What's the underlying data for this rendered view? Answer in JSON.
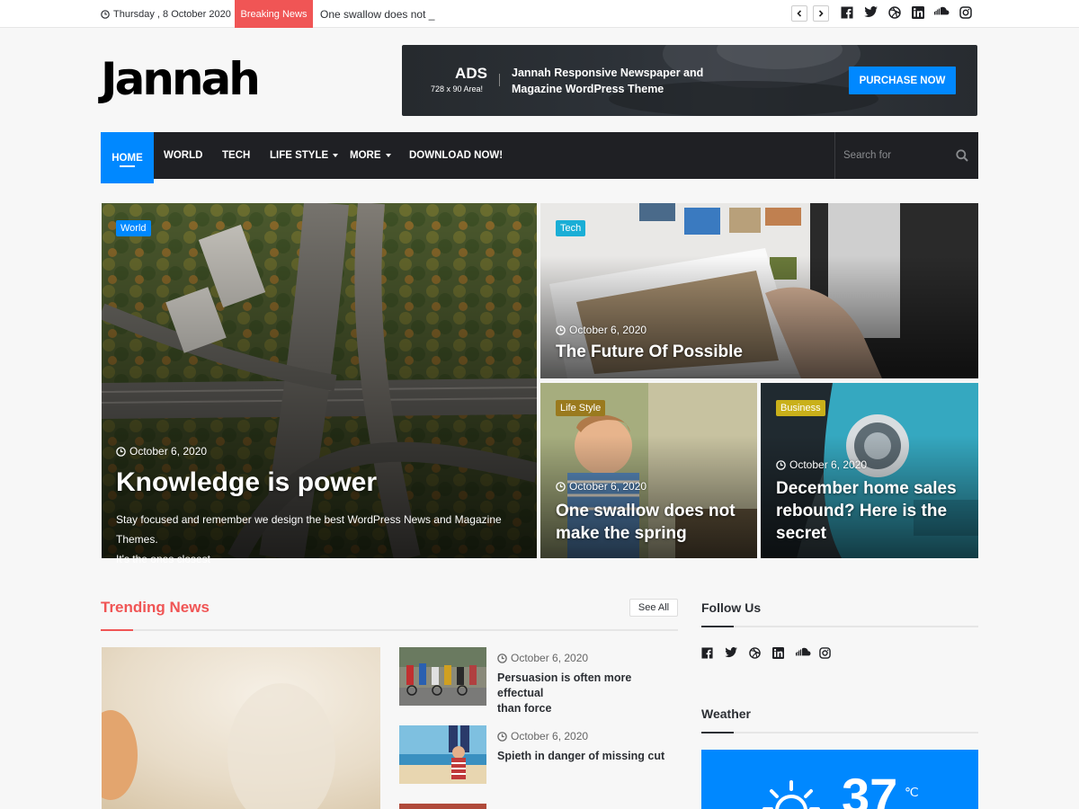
{
  "topbar": {
    "date": "Thursday , 8 October 2020",
    "breaking_label": "Breaking News",
    "ticker_text": "One swallow does not _",
    "social_icons": [
      "facebook-icon",
      "twitter-icon",
      "dribbble-icon",
      "linkedin-icon",
      "soundcloud-icon",
      "instagram-icon"
    ]
  },
  "header": {
    "logo": "Jannah",
    "ad": {
      "title": "ADS",
      "subtitle": "728 x 90 Area!",
      "text_line1": "Jannah Responsive Newspaper and",
      "text_line2": "Magazine WordPress Theme",
      "button": "PURCHASE NOW"
    }
  },
  "nav": {
    "items": [
      {
        "label": "HOME"
      },
      {
        "label": "WORLD"
      },
      {
        "label": "TECH"
      },
      {
        "label": "LIFE STYLE"
      },
      {
        "label": "MORE"
      },
      {
        "label": "DOWNLOAD NOW!"
      }
    ],
    "search_placeholder": "Search for"
  },
  "featured": [
    {
      "category": "World",
      "cat_color": "#0088ff",
      "date": "October 6, 2020",
      "title": "Knowledge is power",
      "excerpt_line1": "Stay focused and remember we design the best WordPress News and Magazine Themes.",
      "excerpt_line2": "It's the ones closest"
    },
    {
      "category": "Tech",
      "cat_color": "#1aaed6",
      "date": "October 6, 2020",
      "title": "The Future Of Possible"
    },
    {
      "category": "Life Style",
      "cat_color": "#9a7a1e",
      "date": "October 6, 2020",
      "title_line1": "One swallow does not",
      "title_line2": "make the spring"
    },
    {
      "category": "Business",
      "cat_color": "#c9b01a",
      "date": "October 6, 2020",
      "title_line1": "December home sales",
      "title_line2": "rebound? Here is the",
      "title_line3": "secret"
    }
  ],
  "trending": {
    "title": "Trending News",
    "see_all": "See All",
    "items": [
      {
        "date": "October 6, 2020",
        "title_line1": "Persuasion is often more effectual",
        "title_line2": "than force"
      },
      {
        "date": "October 6, 2020",
        "title_line1": "Spieth in danger of missing cut"
      }
    ]
  },
  "sidebar": {
    "follow_title": "Follow Us",
    "weather_title": "Weather",
    "temperature": "37",
    "unit": "℃"
  }
}
